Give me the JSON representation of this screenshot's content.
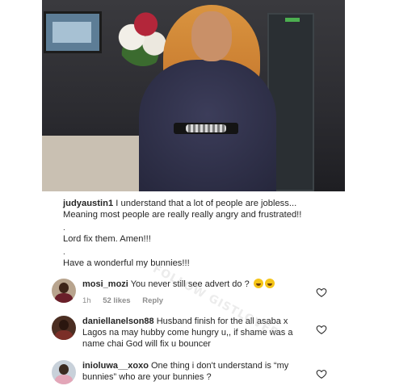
{
  "post": {
    "caption": {
      "username": "judyaustin1",
      "line1": "I understand that a lot of people are jobless...",
      "line2": "Meaning most people are really really angry and frustrated!!",
      "dot1": ".",
      "line3": "Lord fix them. Amen!!!",
      "dot2": ".",
      "line4": "Have a wonderful my bunnies!!!"
    }
  },
  "comments": [
    {
      "username": "mosi_mozi",
      "text": "You never still see advert do ?",
      "emoji": "laughing-tears-emoji",
      "time": "1h",
      "likes": "52 likes",
      "reply": "Reply"
    },
    {
      "username": "daniellanelson88",
      "text": "Husband finish for the all asaba x Lagos na may hubby come hungry u,, if shame was a name chai God will fix u bouncer"
    },
    {
      "username": "inioluwa__xoxo",
      "text": "One thing i don't understand is “my bunnies” who are your bunnies ?"
    }
  ],
  "watermark": "FOLLOW GISTLOVER",
  "icons": {
    "like": "heart-outline-icon"
  }
}
